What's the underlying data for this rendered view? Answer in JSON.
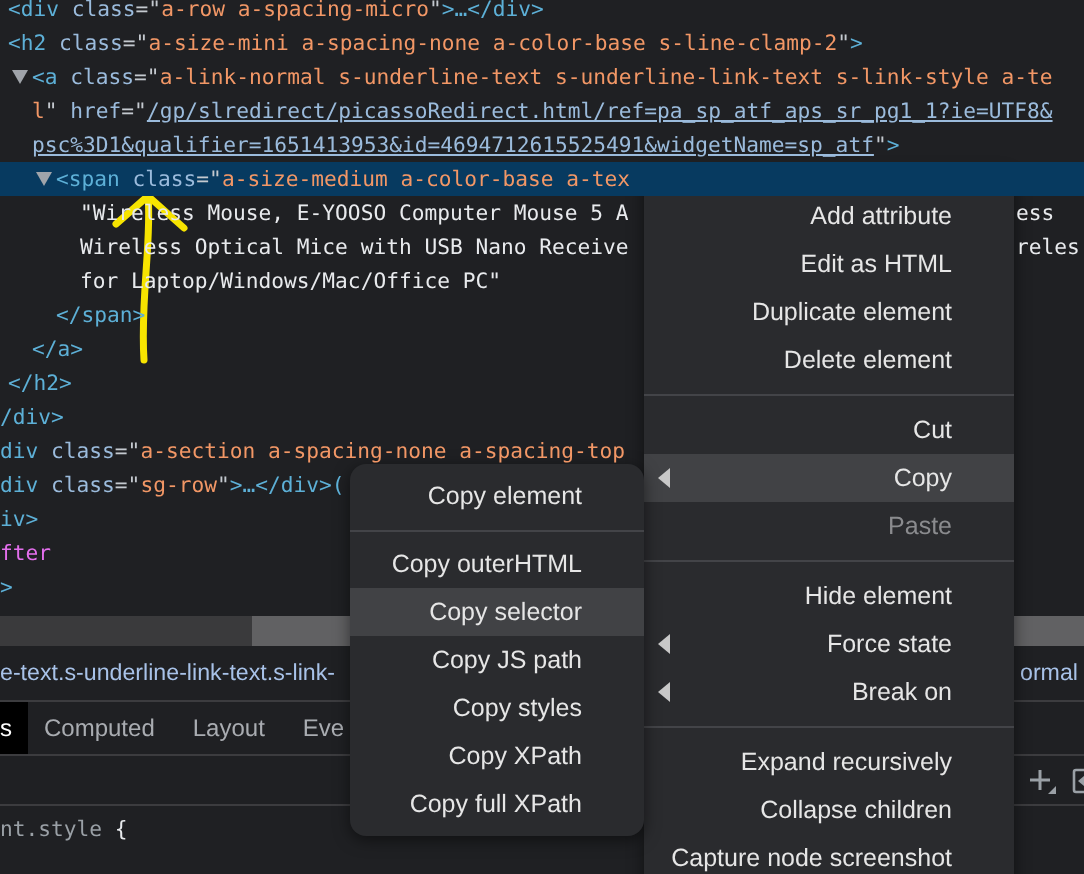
{
  "elements_tree": [
    {
      "children": [
        {
          "selected": false,
          "lines": [
            {
              "segments": [
                {
                  "kind": "tag",
                  "text": "<div"
                },
                {
                  "kind": "attr",
                  "text": " class"
                },
                {
                  "kind": "punct",
                  "text": "=\""
                },
                {
                  "kind": "value",
                  "text": "a-row a-spacing-micro"
                },
                {
                  "kind": "punct",
                  "text": "\""
                },
                {
                  "kind": "tag",
                  "text": ">…</div>"
                }
              ]
            }
          ]
        },
        {
          "selected": false,
          "lines": [
            {
              "segments": [
                {
                  "kind": "tag",
                  "text": "<h2"
                },
                {
                  "kind": "attr",
                  "text": " class"
                },
                {
                  "kind": "punct",
                  "text": "=\""
                },
                {
                  "kind": "value",
                  "text": "a-size-mini a-spacing-none a-color-base s-line-clamp-2"
                },
                {
                  "kind": "punct",
                  "text": "\""
                },
                {
                  "kind": "tag",
                  "text": ">"
                }
              ]
            }
          ],
          "children": [
            {
              "selected": false,
              "expanded": true,
              "lines": [
                {
                  "segments": [
                    {
                      "kind": "tag",
                      "text": "<a"
                    },
                    {
                      "kind": "attr",
                      "text": " class"
                    },
                    {
                      "kind": "punct",
                      "text": "=\""
                    },
                    {
                      "kind": "value",
                      "text": "a-link-normal s-underline-text s-underline-link-text s-link-style a-te"
                    }
                  ]
                },
                {
                  "segments": [
                    {
                      "kind": "value",
                      "text": "l"
                    },
                    {
                      "kind": "punct",
                      "text": "\""
                    },
                    {
                      "kind": "attr",
                      "text": " href"
                    },
                    {
                      "kind": "punct",
                      "text": "=\""
                    },
                    {
                      "kind": "link",
                      "text": "/gp/slredirect/picassoRedirect.html/ref=pa_sp_atf_aps_sr_pg1_1?ie=UTF8&"
                    }
                  ]
                },
                {
                  "segments": [
                    {
                      "kind": "link",
                      "text": "psc%3D1&qualifier=1651413953&id=4694712615525491&widgetName=sp_atf"
                    },
                    {
                      "kind": "punct",
                      "text": "\""
                    },
                    {
                      "kind": "tag",
                      "text": ">"
                    }
                  ]
                }
              ],
              "children": [
                {
                  "selected": true,
                  "expanded": true,
                  "lines": [
                    {
                      "segments": [
                        {
                          "kind": "tag",
                          "text": "<span"
                        },
                        {
                          "kind": "attr",
                          "text": " class"
                        },
                        {
                          "kind": "punct",
                          "text": "=\""
                        },
                        {
                          "kind": "value",
                          "text": "a-size-medium a-color-base a-tex"
                        }
                      ]
                    }
                  ],
                  "children": [
                    {
                      "selected": false,
                      "lines": [
                        {
                          "segments": [
                            {
                              "kind": "text",
                              "text": "\"Wireless Mouse, E-YOOSO Computer Mouse 5 A"
                            }
                          ],
                          "tail": "ess"
                        },
                        {
                          "segments": [
                            {
                              "kind": "text",
                              "text": "Wireless Optical Mice with USB Nano Receive"
                            }
                          ],
                          "tail": "reles"
                        },
                        {
                          "segments": [
                            {
                              "kind": "text",
                              "text": "for Laptop/Windows/Mac/Office PC\""
                            }
                          ]
                        }
                      ]
                    }
                  ],
                  "close": [
                    {
                      "kind": "tag",
                      "text": "</span>"
                    }
                  ]
                }
              ],
              "close": [
                {
                  "kind": "tag",
                  "text": "</a>"
                }
              ]
            }
          ],
          "close": [
            {
              "kind": "tag",
              "text": "</h2>"
            }
          ]
        }
      ],
      "close": [
        {
          "kind": "tag",
          "text": "/div>"
        }
      ]
    },
    {
      "selected": false,
      "lines": [
        {
          "segments": [
            {
              "kind": "tag",
              "text": "div"
            },
            {
              "kind": "attr",
              "text": " class"
            },
            {
              "kind": "punct",
              "text": "=\""
            },
            {
              "kind": "value",
              "text": "a-section a-spacing-none a-spacing-top"
            }
          ]
        }
      ]
    },
    {
      "selected": false,
      "lines": [
        {
          "segments": [
            {
              "kind": "tag",
              "text": "div"
            },
            {
              "kind": "attr",
              "text": " class"
            },
            {
              "kind": "punct",
              "text": "=\""
            },
            {
              "kind": "value",
              "text": "sg-row"
            },
            {
              "kind": "punct",
              "text": "\""
            },
            {
              "kind": "tag",
              "text": ">…</div>("
            }
          ]
        }
      ]
    },
    {
      "selected": false,
      "lines": [
        {
          "segments": [
            {
              "kind": "tag",
              "text": "iv>"
            }
          ]
        }
      ]
    },
    {
      "selected": false,
      "lines": [
        {
          "segments": [
            {
              "kind": "pseudo",
              "text": "fter"
            }
          ]
        }
      ]
    },
    {
      "selected": false,
      "lines": [
        {
          "segments": [
            {
              "kind": "tag",
              "text": ">"
            }
          ]
        }
      ]
    }
  ],
  "breadcrumb": {
    "left": "e-text.s-underline-link-text.s-link-",
    "right": "ormal"
  },
  "tabs": [
    {
      "label": "s",
      "selected": true
    },
    {
      "label": "Computed",
      "selected": false
    },
    {
      "label": "Layout",
      "selected": false
    },
    {
      "label": "Eve",
      "selected": false
    }
  ],
  "styles_line": [
    {
      "kind": "selector",
      "text": "nt.style "
    },
    {
      "kind": "brace",
      "text": "{"
    }
  ],
  "context_menu": [
    {
      "kind": "item",
      "label": "Add attribute",
      "selected": false,
      "disabled": false,
      "submenu": false
    },
    {
      "kind": "item",
      "label": "Edit as HTML",
      "selected": false,
      "disabled": false,
      "submenu": false
    },
    {
      "kind": "item",
      "label": "Duplicate element",
      "selected": false,
      "disabled": false,
      "submenu": false
    },
    {
      "kind": "item",
      "label": "Delete element",
      "selected": false,
      "disabled": false,
      "submenu": false
    },
    {
      "kind": "separator"
    },
    {
      "kind": "item",
      "label": "Cut",
      "selected": false,
      "disabled": false,
      "submenu": false
    },
    {
      "kind": "item",
      "label": "Copy",
      "selected": true,
      "disabled": false,
      "submenu": true
    },
    {
      "kind": "item",
      "label": "Paste",
      "selected": false,
      "disabled": true,
      "submenu": false
    },
    {
      "kind": "separator"
    },
    {
      "kind": "item",
      "label": "Hide element",
      "selected": false,
      "disabled": false,
      "submenu": false
    },
    {
      "kind": "item",
      "label": "Force state",
      "selected": false,
      "disabled": false,
      "submenu": true
    },
    {
      "kind": "item",
      "label": "Break on",
      "selected": false,
      "disabled": false,
      "submenu": true
    },
    {
      "kind": "separator"
    },
    {
      "kind": "item",
      "label": "Expand recursively",
      "selected": false,
      "disabled": false,
      "submenu": false
    },
    {
      "kind": "item",
      "label": "Collapse children",
      "selected": false,
      "disabled": false,
      "submenu": false
    },
    {
      "kind": "item",
      "label": "Capture node screenshot",
      "selected": false,
      "disabled": false,
      "submenu": false
    }
  ],
  "copy_submenu": [
    {
      "kind": "item",
      "label": "Copy element",
      "selected": false
    },
    {
      "kind": "separator"
    },
    {
      "kind": "item",
      "label": "Copy outerHTML",
      "selected": false
    },
    {
      "kind": "item",
      "label": "Copy selector",
      "selected": true
    },
    {
      "kind": "item",
      "label": "Copy JS path",
      "selected": false
    },
    {
      "kind": "item",
      "label": "Copy styles",
      "selected": false
    },
    {
      "kind": "item",
      "label": "Copy XPath",
      "selected": false
    },
    {
      "kind": "item",
      "label": "Copy full XPath",
      "selected": false
    }
  ]
}
